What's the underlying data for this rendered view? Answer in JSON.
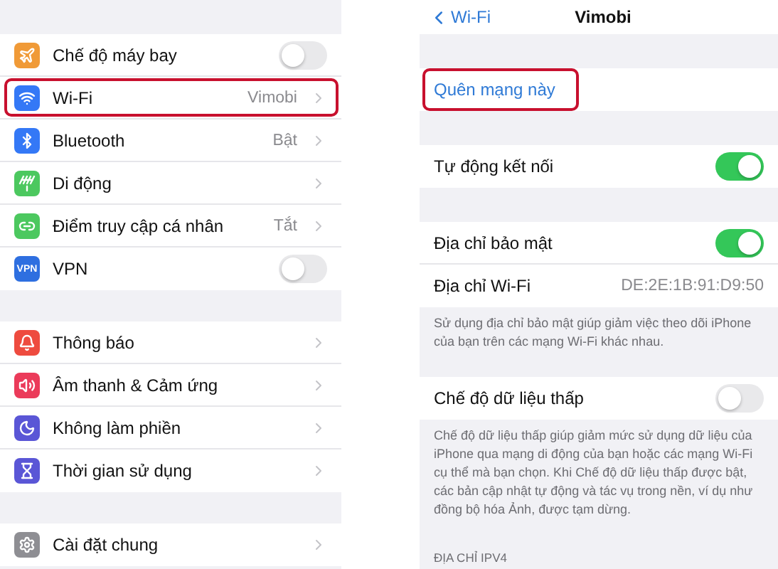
{
  "settings_list": {
    "groups": [
      {
        "items": [
          {
            "color": "#f09a37",
            "label": "Chế độ máy bay",
            "kind": "toggle",
            "on": false,
            "highlighted": false
          },
          {
            "color": "#3478f6",
            "label": "Wi-Fi",
            "kind": "link",
            "value": "Vimobi",
            "highlighted": true
          },
          {
            "color": "#3478f6",
            "label": "Bluetooth",
            "kind": "link",
            "value": "Bật",
            "highlighted": false
          },
          {
            "color": "#4cc85f",
            "label": "Di động",
            "kind": "link",
            "highlighted": false
          },
          {
            "color": "#4cc85f",
            "label": "Điểm truy cập cá nhân",
            "kind": "link",
            "value": "Tắt",
            "highlighted": false
          },
          {
            "glyph": "VPN",
            "color": "#2e6fe0",
            "label": "VPN",
            "kind": "toggle",
            "on": false,
            "highlighted": false
          }
        ]
      },
      {
        "items": [
          {
            "color": "#ee4b3f",
            "label": "Thông báo",
            "kind": "link",
            "highlighted": false
          },
          {
            "color": "#eb3b5a",
            "label": "Âm thanh & Cảm ứng",
            "kind": "link",
            "highlighted": false
          },
          {
            "color": "#5a56d6",
            "label": "Không làm phiền",
            "kind": "link",
            "highlighted": false
          },
          {
            "color": "#5a56d6",
            "label": "Thời gian sử dụng",
            "kind": "link",
            "highlighted": false
          }
        ]
      },
      {
        "items": [
          {
            "color": "#8e8e93",
            "label": "Cài đặt chung",
            "kind": "link",
            "highlighted": false
          }
        ]
      }
    ]
  },
  "network_detail": {
    "nav": {
      "back": "Wi-Fi",
      "title": "Vimobi"
    },
    "groups": [
      {
        "rows": [
          {
            "kind": "action",
            "label": "Quên mạng này",
            "highlighted": true
          }
        ]
      },
      {
        "rows": [
          {
            "kind": "toggle",
            "label": "Tự động kết nối",
            "on": true
          }
        ]
      },
      {
        "rows": [
          {
            "kind": "toggle",
            "label": "Địa chỉ bảo mật",
            "on": true
          },
          {
            "kind": "value",
            "label": "Địa chỉ Wi-Fi",
            "value": "DE:2E:1B:91:D9:50"
          }
        ],
        "footer": "Sử dụng địa chỉ bảo mật giúp giảm việc theo dõi iPhone của bạn trên các mạng Wi-Fi khác nhau."
      },
      {
        "rows": [
          {
            "kind": "toggle",
            "label": "Chế độ dữ liệu thấp",
            "on": false
          }
        ],
        "footer": "Chế độ dữ liệu thấp giúp giảm mức sử dụng dữ liệu của iPhone qua mạng di động của bạn hoặc các mạng Wi-Fi cụ thể mà bạn chọn. Khi Chế độ dữ liệu thấp được bật, các bản cập nhật tự động và tác vụ trong nền, ví dụ như đồng bộ hóa Ảnh, được tạm dừng."
      }
    ],
    "section_header": "ĐỊA CHỈ IPV4"
  }
}
